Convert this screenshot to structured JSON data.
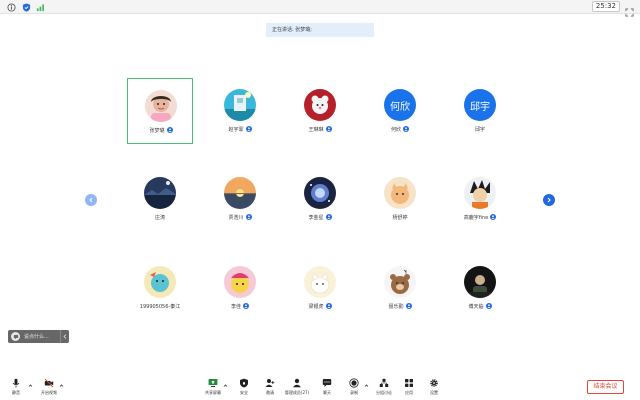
{
  "topbar": {
    "timer": "25:32"
  },
  "banner": {
    "speaking": "正在讲话: 张梦璐;"
  },
  "participants": [
    {
      "name": "张梦璐"
    },
    {
      "name": "赵宇霏"
    },
    {
      "name": "王琳琳"
    },
    {
      "name": "何欣",
      "avatar_text": "何欣"
    },
    {
      "name": "邱宇",
      "avatar_text": "邱宇"
    },
    {
      "name": "庄涛"
    },
    {
      "name": "贾浩川"
    },
    {
      "name": "李金星"
    },
    {
      "name": "杨舒婷"
    },
    {
      "name": "高鹿宇fine"
    },
    {
      "name": "199905056-秦江"
    },
    {
      "name": "李佳"
    },
    {
      "name": "梁银虎"
    },
    {
      "name": "聂乐勤"
    },
    {
      "name": "傅天临"
    }
  ],
  "chat": {
    "placeholder": "说点什么..."
  },
  "toolbar": {
    "mute": "静音",
    "video": "开启视频",
    "share": "共享屏幕",
    "security": "安全",
    "invite": "邀请",
    "participants": "管理成员(27)",
    "chat": "聊天",
    "record": "录制",
    "breakout": "分组讨论",
    "apps": "应用",
    "settings": "设置",
    "end": "结束会议"
  },
  "colors": {
    "accent": "#2468e0",
    "active_border": "#4bbf73",
    "end_red": "#e0463a"
  }
}
